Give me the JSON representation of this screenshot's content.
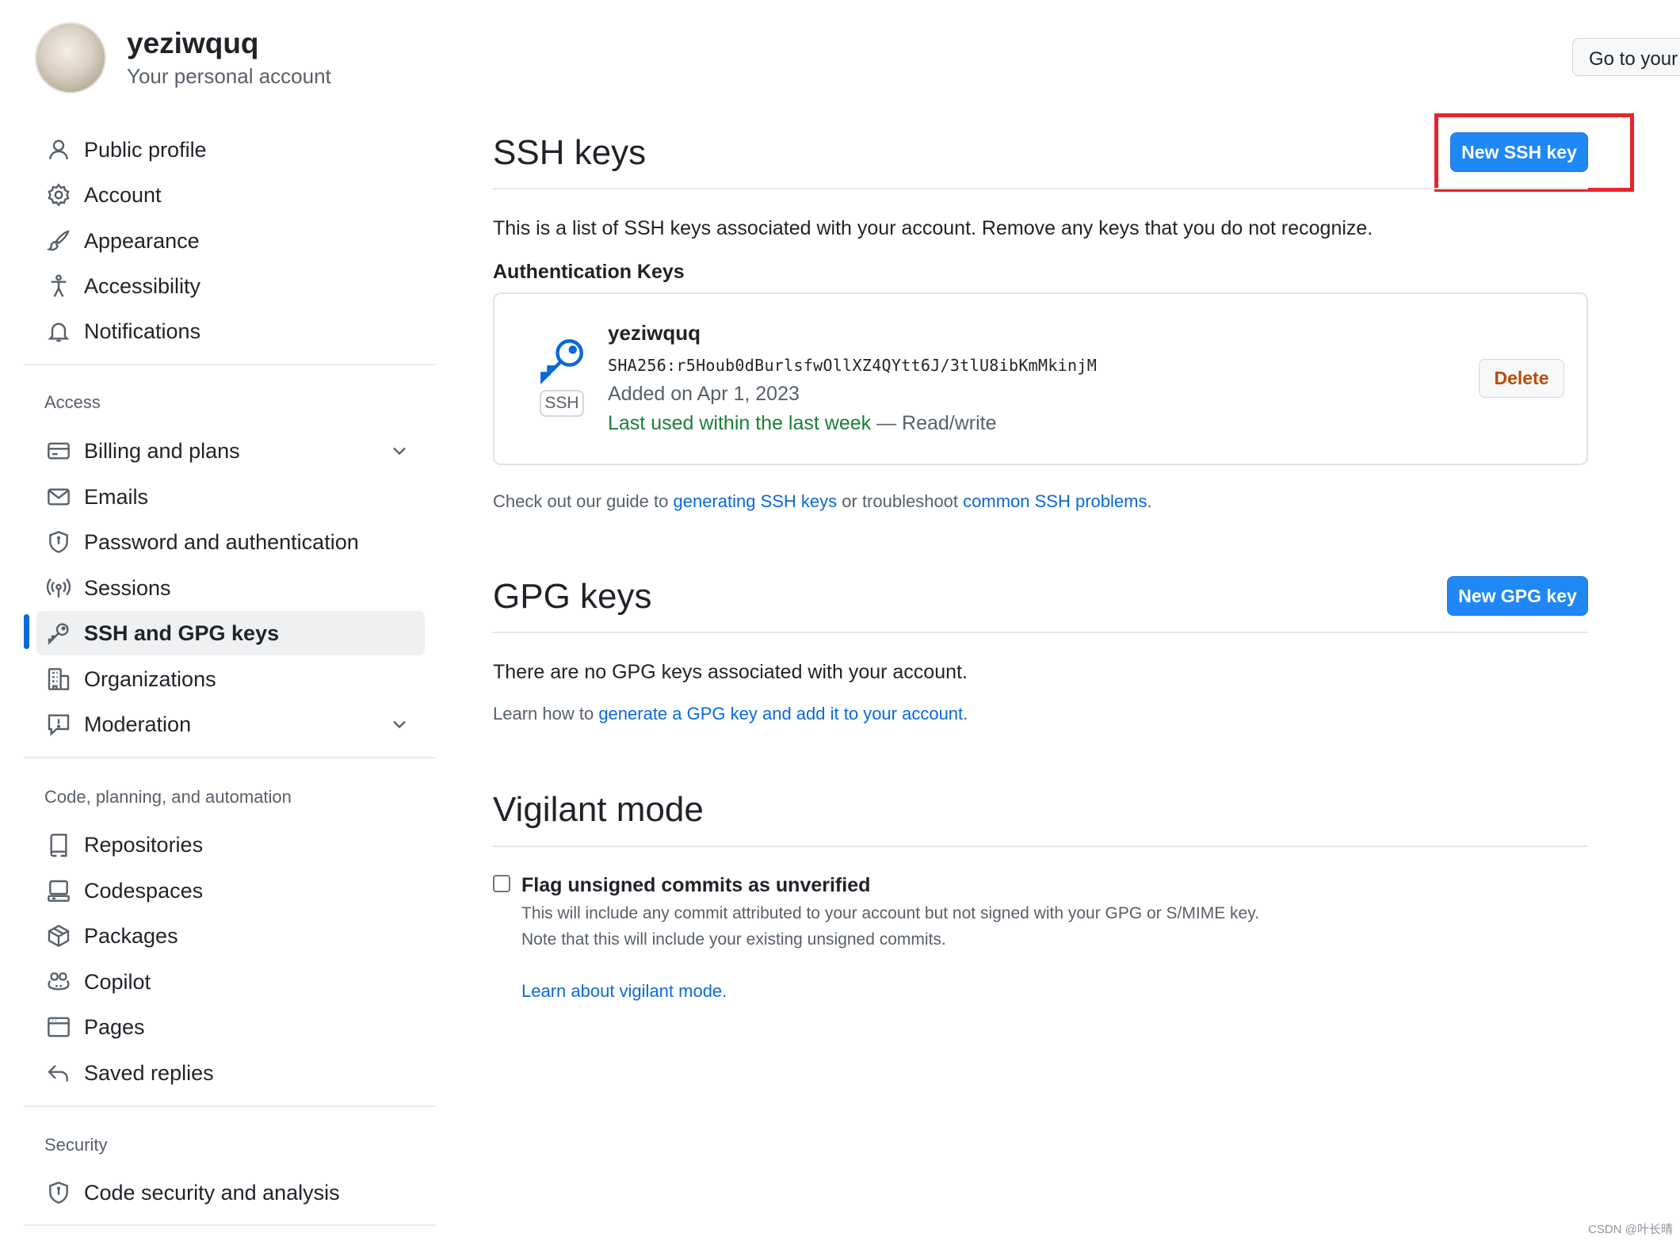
{
  "header": {
    "username": "yeziwquq",
    "subtitle": "Your personal account",
    "goto_label": "Go to your p"
  },
  "sidebar": {
    "top_items": [
      {
        "label": "Public profile",
        "icon": "person-icon"
      },
      {
        "label": "Account",
        "icon": "gear-icon"
      },
      {
        "label": "Appearance",
        "icon": "paintbrush-icon"
      },
      {
        "label": "Accessibility",
        "icon": "accessibility-icon"
      },
      {
        "label": "Notifications",
        "icon": "bell-icon"
      }
    ],
    "access_heading": "Access",
    "access_items": [
      {
        "label": "Billing and plans",
        "icon": "credit-card-icon"
      },
      {
        "label": "Emails",
        "icon": "mail-icon"
      },
      {
        "label": "Password and authentication",
        "icon": "shield-icon"
      },
      {
        "label": "Sessions",
        "icon": "broadcast-icon"
      },
      {
        "label": "SSH and GPG keys",
        "icon": "key-icon"
      },
      {
        "label": "Organizations",
        "icon": "organization-icon"
      },
      {
        "label": "Moderation",
        "icon": "report-icon"
      }
    ],
    "code_heading": "Code, planning, and automation",
    "code_items": [
      {
        "label": "Repositories",
        "icon": "repo-icon"
      },
      {
        "label": "Codespaces",
        "icon": "codespaces-icon"
      },
      {
        "label": "Packages",
        "icon": "package-icon"
      },
      {
        "label": "Copilot",
        "icon": "copilot-icon"
      },
      {
        "label": "Pages",
        "icon": "browser-icon"
      },
      {
        "label": "Saved replies",
        "icon": "reply-icon"
      }
    ],
    "security_heading": "Security",
    "security_items": [
      {
        "label": "Code security and analysis",
        "icon": "shield-icon"
      }
    ]
  },
  "ssh": {
    "title": "SSH keys",
    "new_button": "New SSH key",
    "description": "This is a list of SSH keys associated with your account. Remove any keys that you do not recognize.",
    "auth_heading": "Authentication Keys",
    "key": {
      "name": "yeziwquq",
      "fingerprint": "SHA256:r5Houb0dBurlsfwOllXZ4QYtt6J/3tlU8ibKmMkinjM",
      "added": "Added on Apr 1, 2023",
      "last_used": "Last used within the last week",
      "access": " — Read/write",
      "badge": "SSH",
      "delete_label": "Delete"
    },
    "guide_prefix": "Check out our guide to ",
    "guide_link1": "generating SSH keys",
    "guide_middle": " or troubleshoot ",
    "guide_link2": "common SSH problems",
    "guide_suffix": "."
  },
  "gpg": {
    "title": "GPG keys",
    "new_button": "New GPG key",
    "empty": "There are no GPG keys associated with your account.",
    "learn_prefix": "Learn how to ",
    "learn_link": "generate a GPG key and add it to your account",
    "learn_suffix": "."
  },
  "vigilant": {
    "title": "Vigilant mode",
    "checkbox_label": "Flag unsigned commits as unverified",
    "desc1": "This will include any commit attributed to your account but not signed with your GPG or S/MIME key.",
    "desc2": "Note that this will include your existing unsigned commits.",
    "learn_link": "Learn about vigilant mode",
    "learn_suffix": "."
  },
  "watermark": "CSDN @叶长晴",
  "colors": {
    "primary_button": "#1f88f5",
    "link": "#0969da",
    "active_bar": "#0969da",
    "highlight": "#e8252b",
    "danger": "#bc4c00",
    "success": "#1a7f37"
  }
}
